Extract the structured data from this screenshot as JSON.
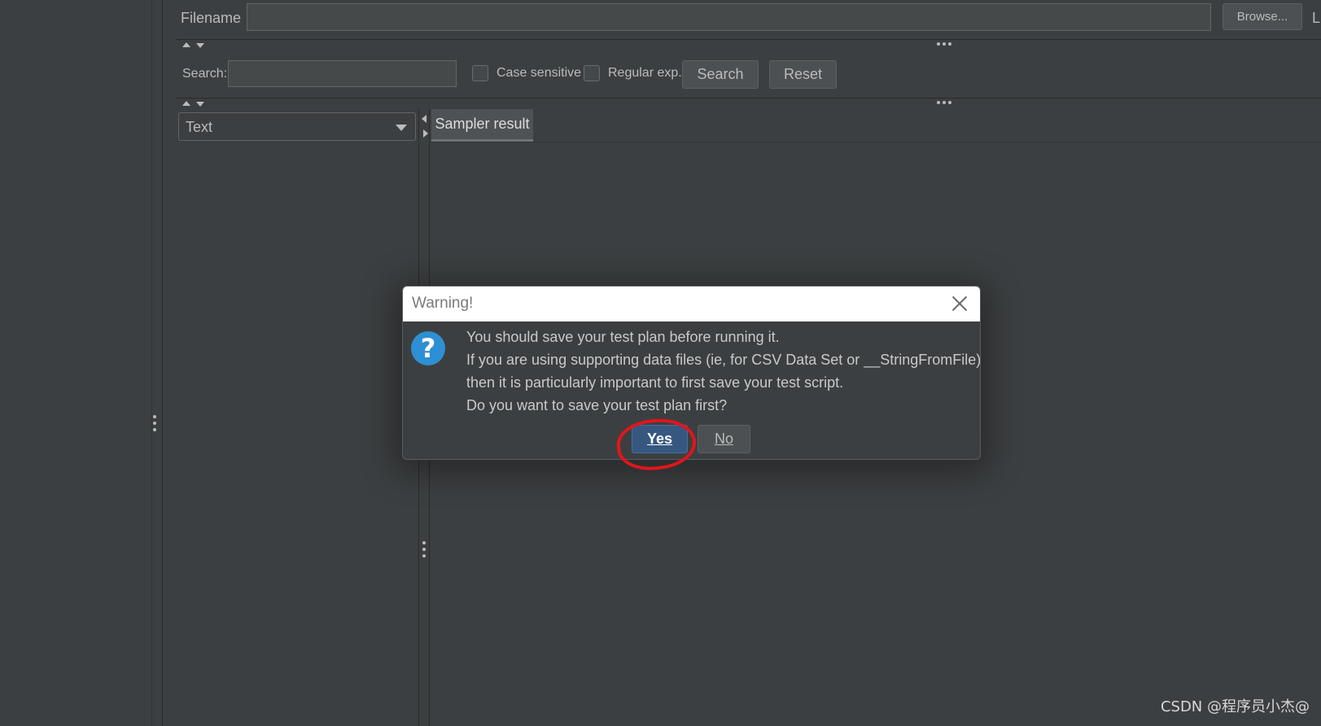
{
  "file_panel": {
    "filename_label": "Filename",
    "filename_value": "",
    "browse_label": "Browse...",
    "edge_label": "L"
  },
  "search_panel": {
    "search_label": "Search:",
    "search_value": "",
    "case_sensitive_label": "Case sensitive",
    "regular_exp_label": "Regular exp.",
    "search_button": "Search",
    "reset_button": "Reset"
  },
  "results": {
    "renderer_selected": "Text",
    "tabs": [
      {
        "label": "Sampler result"
      }
    ]
  },
  "dialog": {
    "title": "Warning!",
    "icon": "question-icon",
    "messages": [
      "You should save your test plan before running it.",
      "If you are using supporting data files (ie, for CSV Data Set or __StringFromFile),",
      "then it is particularly important to first save your test script.",
      "Do you want to save your test plan first?"
    ],
    "yes_label": "Yes",
    "no_label": "No"
  },
  "annotation": {
    "color": "#e0161b"
  },
  "watermark": "CSDN @程序员小杰@"
}
